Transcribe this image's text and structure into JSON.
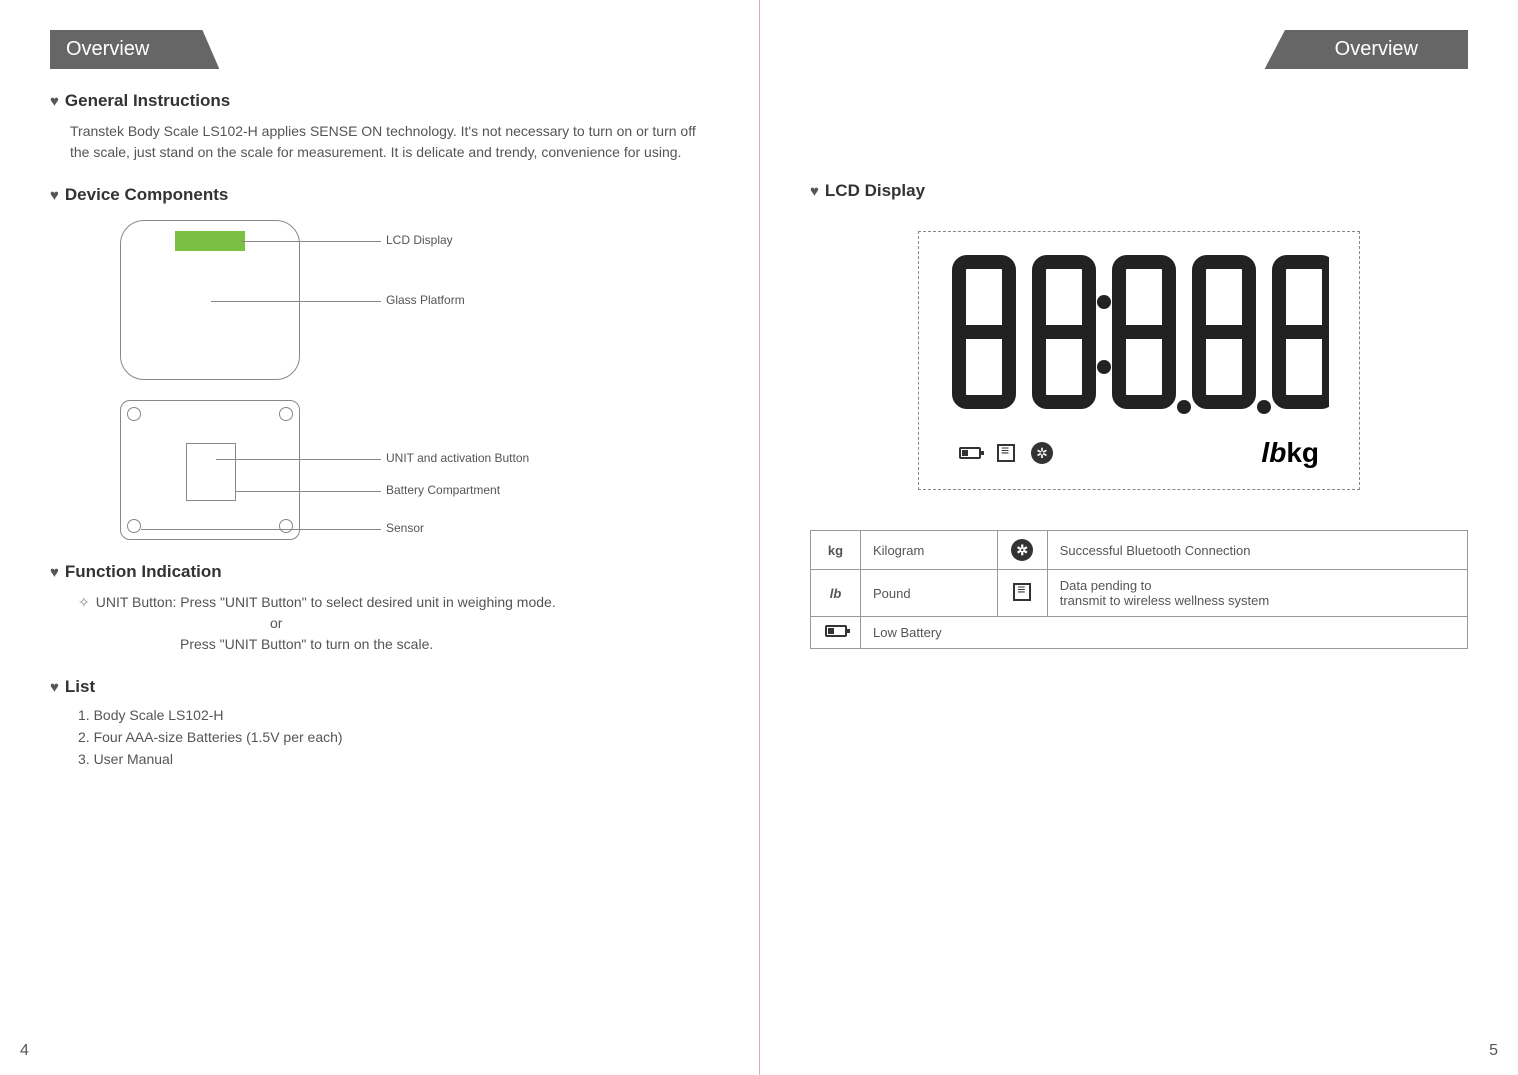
{
  "left": {
    "tab": "Overview",
    "sections": {
      "general": {
        "heading": "General Instructions",
        "para": "Transtek Body Scale LS102-H applies SENSE ON technology. It's not necessary to turn on or turn off the scale, just stand on the scale for measurement. It is delicate and trendy, convenience for using."
      },
      "components": {
        "heading": "Device Components",
        "callouts": {
          "lcd": "LCD Display",
          "glass": "Glass Platform",
          "unit": "UNIT and activation Button",
          "battery": "Battery Compartment",
          "sensor": "Sensor"
        }
      },
      "function": {
        "heading": "Function Indication",
        "line1": "UNIT Button: Press \"UNIT Button\" to select desired unit in weighing mode.",
        "or": "or",
        "line2": "Press \"UNIT Button\" to turn on the scale."
      },
      "list": {
        "heading": "List",
        "items": [
          "1. Body Scale LS102-H",
          "2. Four AAA-size Batteries (1.5V per each)",
          "3. User Manual"
        ]
      }
    },
    "pageNum": "4"
  },
  "right": {
    "tab": "Overview",
    "lcd_heading": "LCD Display",
    "unit_lb": "lb",
    "unit_kg": "kg",
    "legend": [
      {
        "icon": "kg",
        "text": "Kilogram"
      },
      {
        "icon": "lb",
        "text": "Pound"
      },
      {
        "icon": "battery",
        "text": "Low Battery"
      },
      {
        "icon": "bt",
        "text": "Successful Bluetooth Connection"
      },
      {
        "icon": "data",
        "text1": "Data pending to",
        "text2": "transmit to wireless wellness system"
      }
    ],
    "pageNum": "5"
  }
}
